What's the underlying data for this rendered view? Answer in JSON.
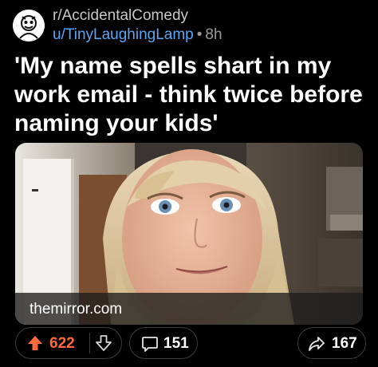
{
  "post": {
    "subreddit": "r/AccidentalComedy",
    "username": "u/TinyLaughingLamp",
    "separator": "•",
    "age": "8h",
    "title": "'My name spells shart in my work email - think twice before naming your kids'"
  },
  "media": {
    "link_domain": "themirror.com",
    "image": "photo of smiling woman with blonde hair and bangs"
  },
  "actions": {
    "upvotes": "622",
    "comments": "151",
    "shares": "167",
    "upvote_color": "#ff6a3d"
  },
  "icons": {
    "avatar": "subreddit-avatar-icon",
    "upvote": "upvote-arrow-icon",
    "downvote": "downvote-arrow-icon",
    "comment": "comment-bubble-icon",
    "share": "share-arrow-icon"
  }
}
